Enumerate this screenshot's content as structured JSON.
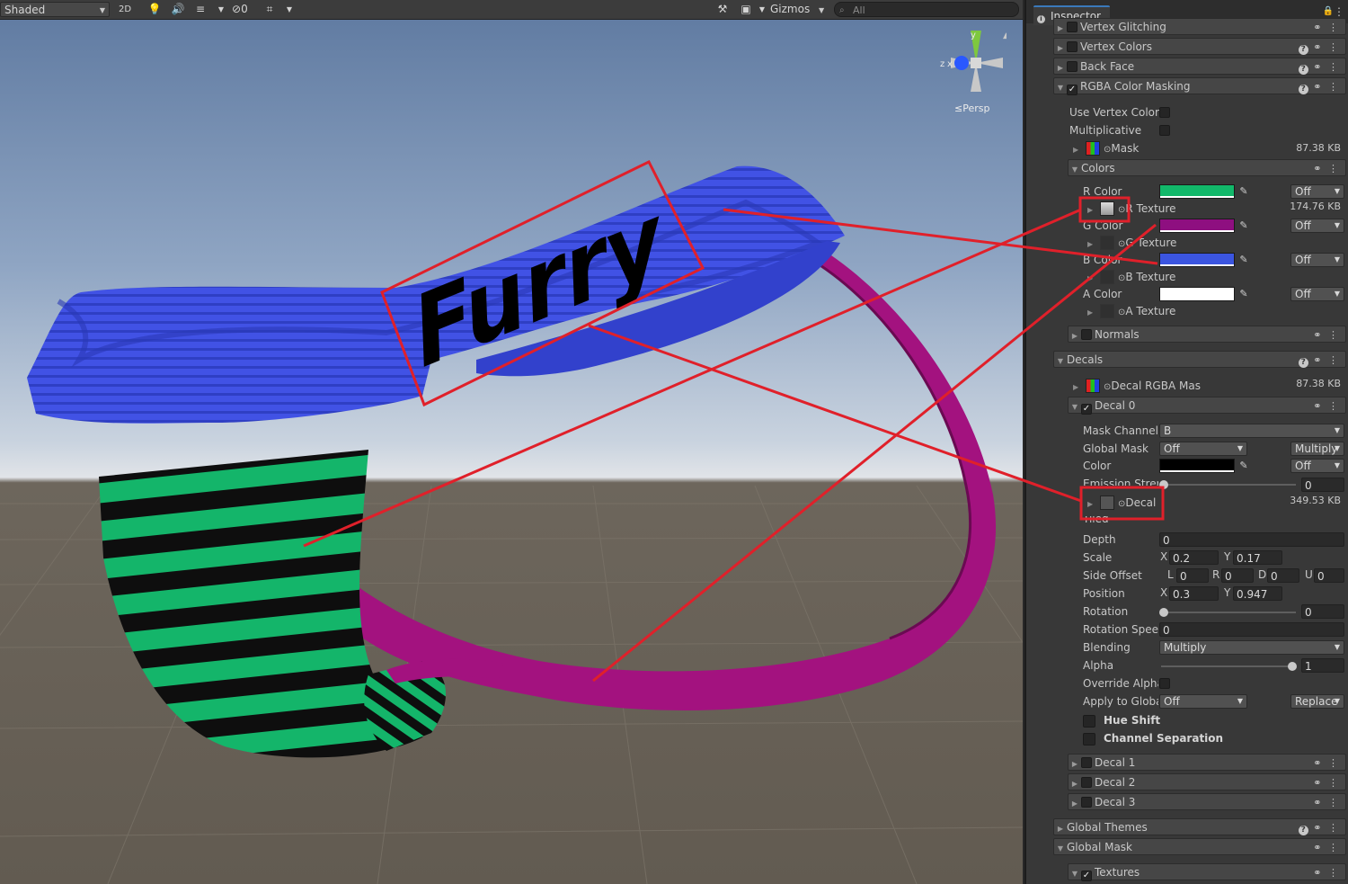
{
  "toolbar": {
    "shading_mode": "Shaded",
    "mode_2d": "2D",
    "hidden_count": "0",
    "gizmos_label": "Gizmos",
    "search_placeholder": "All"
  },
  "viewport": {
    "projection_label": "Persp",
    "axis_y": "y",
    "axis_z": "z",
    "axis_x": "x",
    "decal_text": "Furry",
    "colors": {
      "band": "#4052e6",
      "strap": "#a0107f",
      "pouch_green": "#14b56a",
      "pouch_black": "#0e0e0e",
      "highlight": "#e0202a"
    }
  },
  "inspector": {
    "title": "Inspector",
    "sections_top": [
      {
        "label": "Vertex Glitching",
        "checked": false
      },
      {
        "label": "Vertex Colors",
        "checked": false
      },
      {
        "label": "Back Face",
        "checked": false
      },
      {
        "label": "RGBA Color Masking",
        "checked": true
      }
    ],
    "rgba": {
      "use_vertex_colors": "Use Vertex Colors",
      "multiplicative": "Multiplicative",
      "mask_label": "Mask",
      "mask_size": "87.38 KB",
      "colors_header": "Colors",
      "r_color": "R Color",
      "r_texture": "R Texture",
      "r_size": "174.76 KB",
      "g_color": "G Color",
      "g_texture": "G Texture",
      "b_color": "B Color",
      "b_texture": "B Texture",
      "a_color": "A Color",
      "a_texture": "A Texture",
      "off": "Off",
      "normals": "Normals",
      "swatch_r": "#12b86a",
      "swatch_g": "#8e0f80",
      "swatch_b": "#3b55e0",
      "swatch_a": "#ffffff"
    },
    "decals": {
      "header": "Decals",
      "mask_label": "Decal RGBA Mas",
      "mask_size": "87.38 KB",
      "decal0": "Decal 0",
      "mask_channel_label": "Mask Channel",
      "mask_channel_value": "B",
      "global_mask_label": "Global Mask",
      "global_mask_value": "Off",
      "global_mask_mode": "Multiply",
      "color_label": "Color",
      "color_mode": "Off",
      "color_swatch": "#000000",
      "emission_label": "Emission Stren",
      "emission_value": "0",
      "decal_tex_label": "Decal",
      "decal_tex_size": "349.53 KB",
      "tiled_label": "Tiled",
      "depth_label": "Depth",
      "depth_value": "0",
      "scale_label": "Scale",
      "scale_x": "0.2",
      "scale_y": "0.17",
      "side_offset_label": "Side Offset",
      "side_l": "0",
      "side_r": "0",
      "side_d": "0",
      "side_u": "0",
      "position_label": "Position",
      "pos_x": "0.3",
      "pos_y": "0.947",
      "rotation_label": "Rotation",
      "rotation_value": "0",
      "rotation_speed_label": "Rotation Speed",
      "rotation_speed_value": "0",
      "blending_label": "Blending",
      "blending_value": "Multiply",
      "alpha_label": "Alpha",
      "alpha_value": "1",
      "override_alpha_label": "Override Alpha",
      "apply_global_label": "Apply to Global",
      "apply_global_value": "Off",
      "apply_global_mode": "Replace",
      "hue_shift": "Hue Shift",
      "channel_separation": "Channel Separation",
      "decal1": "Decal 1",
      "decal2": "Decal 2",
      "decal3": "Decal 3"
    },
    "global_themes": "Global Themes",
    "global_mask": "Global Mask",
    "textures": "Textures",
    "axis_x": "X",
    "axis_y": "Y",
    "side_l_letter": "L",
    "side_r_letter": "R",
    "side_d_letter": "D",
    "side_u_letter": "U"
  }
}
